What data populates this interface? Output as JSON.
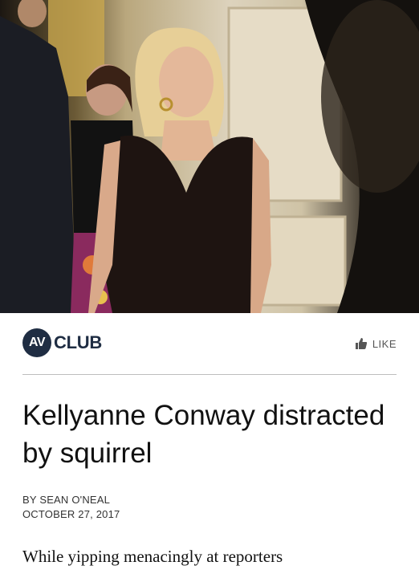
{
  "photo": {
    "description_icon": "photo-image"
  },
  "brand": {
    "logo_mark": "AV",
    "logo_text": "CLUB"
  },
  "actions": {
    "like_label": "LIKE",
    "like_icon": "thumbs-up-icon"
  },
  "article": {
    "headline": "Kellyanne Conway distracted by squirrel",
    "byline": "BY SEAN O'NEAL",
    "date": "OCTOBER 27, 2017",
    "excerpt": "While yipping menacingly at reporters"
  }
}
